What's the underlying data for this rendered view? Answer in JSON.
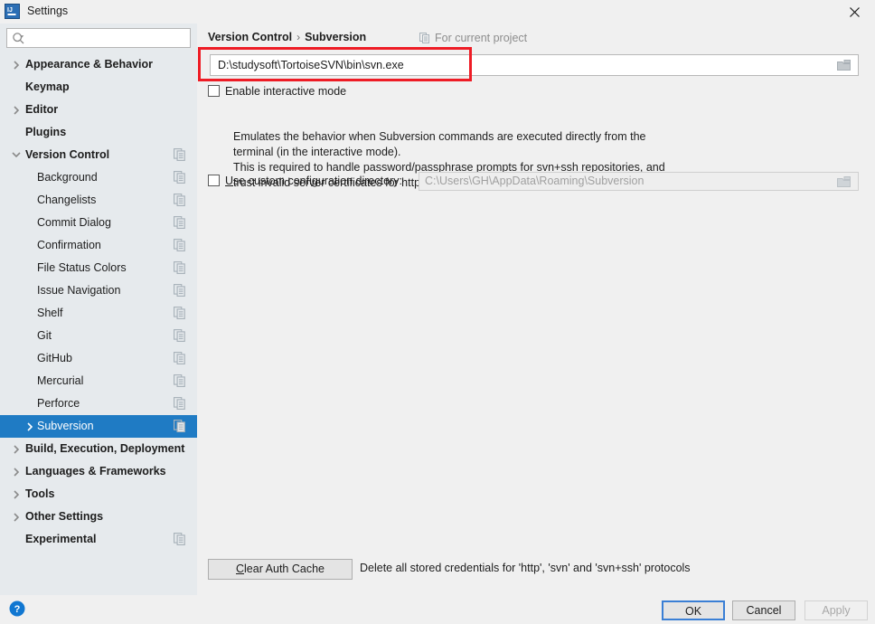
{
  "window": {
    "title": "Settings",
    "logo_icon": "intellij-idea-logo",
    "close_icon": "close-icon"
  },
  "search": {
    "value": "",
    "placeholder": "",
    "icon": "search-icon"
  },
  "sidebar": {
    "scope_icon": "project-scope-icon",
    "items": [
      {
        "label": "Appearance & Behavior",
        "level": 0,
        "twisty": "chevron-right",
        "scope_icon": false,
        "selected": false
      },
      {
        "label": "Keymap",
        "level": 0,
        "twisty": "none",
        "scope_icon": false,
        "selected": false
      },
      {
        "label": "Editor",
        "level": 0,
        "twisty": "chevron-right",
        "scope_icon": false,
        "selected": false
      },
      {
        "label": "Plugins",
        "level": 0,
        "twisty": "none",
        "scope_icon": false,
        "selected": false
      },
      {
        "label": "Version Control",
        "level": 0,
        "twisty": "chevron-down",
        "scope_icon": true,
        "selected": false
      },
      {
        "label": "Background",
        "level": 1,
        "twisty": "none",
        "scope_icon": true,
        "selected": false
      },
      {
        "label": "Changelists",
        "level": 1,
        "twisty": "none",
        "scope_icon": true,
        "selected": false
      },
      {
        "label": "Commit Dialog",
        "level": 1,
        "twisty": "none",
        "scope_icon": true,
        "selected": false
      },
      {
        "label": "Confirmation",
        "level": 1,
        "twisty": "none",
        "scope_icon": true,
        "selected": false
      },
      {
        "label": "File Status Colors",
        "level": 1,
        "twisty": "none",
        "scope_icon": true,
        "selected": false
      },
      {
        "label": "Issue Navigation",
        "level": 1,
        "twisty": "none",
        "scope_icon": true,
        "selected": false
      },
      {
        "label": "Shelf",
        "level": 1,
        "twisty": "none",
        "scope_icon": true,
        "selected": false
      },
      {
        "label": "Git",
        "level": 1,
        "twisty": "none",
        "scope_icon": true,
        "selected": false
      },
      {
        "label": "GitHub",
        "level": 1,
        "twisty": "none",
        "scope_icon": true,
        "selected": false
      },
      {
        "label": "Mercurial",
        "level": 1,
        "twisty": "none",
        "scope_icon": true,
        "selected": false
      },
      {
        "label": "Perforce",
        "level": 1,
        "twisty": "none",
        "scope_icon": true,
        "selected": false
      },
      {
        "label": "Subversion",
        "level": 1,
        "twisty": "chevron-right",
        "scope_icon": true,
        "selected": true
      },
      {
        "label": "Build, Execution, Deployment",
        "level": 0,
        "twisty": "chevron-right",
        "scope_icon": false,
        "selected": false
      },
      {
        "label": "Languages & Frameworks",
        "level": 0,
        "twisty": "chevron-right",
        "scope_icon": false,
        "selected": false
      },
      {
        "label": "Tools",
        "level": 0,
        "twisty": "chevron-right",
        "scope_icon": false,
        "selected": false
      },
      {
        "label": "Other Settings",
        "level": 0,
        "twisty": "chevron-right",
        "scope_icon": false,
        "selected": false
      },
      {
        "label": "Experimental",
        "level": 0,
        "twisty": "none",
        "scope_icon": true,
        "selected": false
      }
    ]
  },
  "main": {
    "breadcrumb": {
      "parent": "Version Control",
      "separator": "›",
      "current": "Subversion"
    },
    "scope_note": {
      "text": "For current project",
      "icon": "project-scope-icon"
    },
    "path_field": {
      "value": "D:\\studysoft\\TortoiseSVN\\bin\\svn.exe",
      "placeholder": "",
      "browse_icon": "folder-browse-icon"
    },
    "interactive_mode": {
      "label": "Enable interactive mode",
      "checked": false,
      "description_lines": [
        "Emulates the behavior when Subversion commands are executed directly from the",
        "terminal (in the interactive mode).",
        "This is required to handle password/passphrase prompts for svn+ssh repositories, and",
        "trust invalid server certificates for https repositories."
      ]
    },
    "custom_config_dir": {
      "label_mnemonic": "U",
      "label_rest": "se custom configuration directory:",
      "checked": false,
      "value": "C:\\Users\\GH\\AppData\\Roaming\\Subversion",
      "browse_icon": "folder-browse-icon"
    },
    "clear_auth": {
      "button_mnemonic": "C",
      "button_rest": "lear Auth Cache",
      "note": "Delete all stored credentials for 'http', 'svn' and 'svn+ssh' protocols"
    }
  },
  "footer": {
    "help_icon": "help-icon",
    "ok_label": "OK",
    "cancel_label": "Cancel",
    "apply_label": "Apply",
    "apply_disabled": true
  },
  "annotation": {
    "color": "#ee1c25",
    "shape": "rectangle-highlight"
  }
}
